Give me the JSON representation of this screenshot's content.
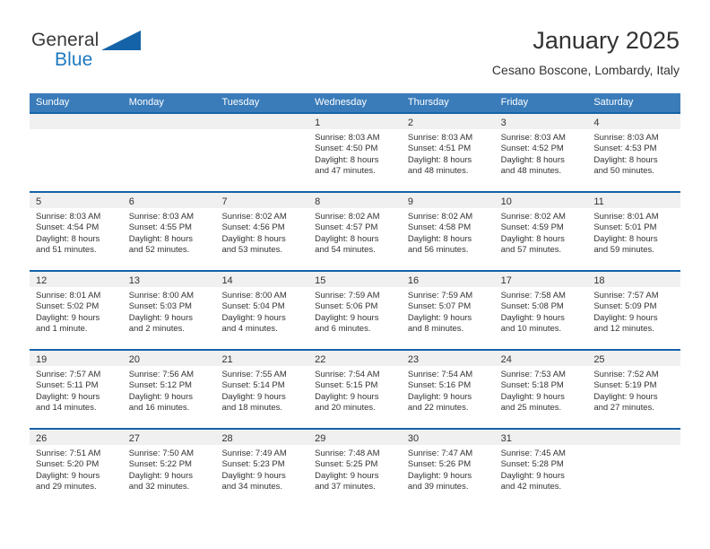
{
  "brand": {
    "word_one": "General",
    "word_two": "Blue",
    "logo_icon": "blue-triangle-icon"
  },
  "header": {
    "title": "January 2025",
    "location": "Cesano Boscone, Lombardy, Italy"
  },
  "colors": {
    "header_blue": "#3a7cba",
    "row_border_blue": "#1463a8",
    "day_band_gray": "#f0f0f0",
    "brand_blue": "#1c79c0",
    "text": "#333333"
  },
  "weekdays": [
    "Sunday",
    "Monday",
    "Tuesday",
    "Wednesday",
    "Thursday",
    "Friday",
    "Saturday"
  ],
  "weeks": [
    [
      {
        "day": "",
        "empty": true
      },
      {
        "day": "",
        "empty": true
      },
      {
        "day": "",
        "empty": true
      },
      {
        "day": "1",
        "sunrise": "Sunrise: 8:03 AM",
        "sunset": "Sunset: 4:50 PM",
        "daylight_1": "Daylight: 8 hours",
        "daylight_2": "and 47 minutes."
      },
      {
        "day": "2",
        "sunrise": "Sunrise: 8:03 AM",
        "sunset": "Sunset: 4:51 PM",
        "daylight_1": "Daylight: 8 hours",
        "daylight_2": "and 48 minutes."
      },
      {
        "day": "3",
        "sunrise": "Sunrise: 8:03 AM",
        "sunset": "Sunset: 4:52 PM",
        "daylight_1": "Daylight: 8 hours",
        "daylight_2": "and 48 minutes."
      },
      {
        "day": "4",
        "sunrise": "Sunrise: 8:03 AM",
        "sunset": "Sunset: 4:53 PM",
        "daylight_1": "Daylight: 8 hours",
        "daylight_2": "and 50 minutes."
      }
    ],
    [
      {
        "day": "5",
        "sunrise": "Sunrise: 8:03 AM",
        "sunset": "Sunset: 4:54 PM",
        "daylight_1": "Daylight: 8 hours",
        "daylight_2": "and 51 minutes."
      },
      {
        "day": "6",
        "sunrise": "Sunrise: 8:03 AM",
        "sunset": "Sunset: 4:55 PM",
        "daylight_1": "Daylight: 8 hours",
        "daylight_2": "and 52 minutes."
      },
      {
        "day": "7",
        "sunrise": "Sunrise: 8:02 AM",
        "sunset": "Sunset: 4:56 PM",
        "daylight_1": "Daylight: 8 hours",
        "daylight_2": "and 53 minutes."
      },
      {
        "day": "8",
        "sunrise": "Sunrise: 8:02 AM",
        "sunset": "Sunset: 4:57 PM",
        "daylight_1": "Daylight: 8 hours",
        "daylight_2": "and 54 minutes."
      },
      {
        "day": "9",
        "sunrise": "Sunrise: 8:02 AM",
        "sunset": "Sunset: 4:58 PM",
        "daylight_1": "Daylight: 8 hours",
        "daylight_2": "and 56 minutes."
      },
      {
        "day": "10",
        "sunrise": "Sunrise: 8:02 AM",
        "sunset": "Sunset: 4:59 PM",
        "daylight_1": "Daylight: 8 hours",
        "daylight_2": "and 57 minutes."
      },
      {
        "day": "11",
        "sunrise": "Sunrise: 8:01 AM",
        "sunset": "Sunset: 5:01 PM",
        "daylight_1": "Daylight: 8 hours",
        "daylight_2": "and 59 minutes."
      }
    ],
    [
      {
        "day": "12",
        "sunrise": "Sunrise: 8:01 AM",
        "sunset": "Sunset: 5:02 PM",
        "daylight_1": "Daylight: 9 hours",
        "daylight_2": "and 1 minute."
      },
      {
        "day": "13",
        "sunrise": "Sunrise: 8:00 AM",
        "sunset": "Sunset: 5:03 PM",
        "daylight_1": "Daylight: 9 hours",
        "daylight_2": "and 2 minutes."
      },
      {
        "day": "14",
        "sunrise": "Sunrise: 8:00 AM",
        "sunset": "Sunset: 5:04 PM",
        "daylight_1": "Daylight: 9 hours",
        "daylight_2": "and 4 minutes."
      },
      {
        "day": "15",
        "sunrise": "Sunrise: 7:59 AM",
        "sunset": "Sunset: 5:06 PM",
        "daylight_1": "Daylight: 9 hours",
        "daylight_2": "and 6 minutes."
      },
      {
        "day": "16",
        "sunrise": "Sunrise: 7:59 AM",
        "sunset": "Sunset: 5:07 PM",
        "daylight_1": "Daylight: 9 hours",
        "daylight_2": "and 8 minutes."
      },
      {
        "day": "17",
        "sunrise": "Sunrise: 7:58 AM",
        "sunset": "Sunset: 5:08 PM",
        "daylight_1": "Daylight: 9 hours",
        "daylight_2": "and 10 minutes."
      },
      {
        "day": "18",
        "sunrise": "Sunrise: 7:57 AM",
        "sunset": "Sunset: 5:09 PM",
        "daylight_1": "Daylight: 9 hours",
        "daylight_2": "and 12 minutes."
      }
    ],
    [
      {
        "day": "19",
        "sunrise": "Sunrise: 7:57 AM",
        "sunset": "Sunset: 5:11 PM",
        "daylight_1": "Daylight: 9 hours",
        "daylight_2": "and 14 minutes."
      },
      {
        "day": "20",
        "sunrise": "Sunrise: 7:56 AM",
        "sunset": "Sunset: 5:12 PM",
        "daylight_1": "Daylight: 9 hours",
        "daylight_2": "and 16 minutes."
      },
      {
        "day": "21",
        "sunrise": "Sunrise: 7:55 AM",
        "sunset": "Sunset: 5:14 PM",
        "daylight_1": "Daylight: 9 hours",
        "daylight_2": "and 18 minutes."
      },
      {
        "day": "22",
        "sunrise": "Sunrise: 7:54 AM",
        "sunset": "Sunset: 5:15 PM",
        "daylight_1": "Daylight: 9 hours",
        "daylight_2": "and 20 minutes."
      },
      {
        "day": "23",
        "sunrise": "Sunrise: 7:54 AM",
        "sunset": "Sunset: 5:16 PM",
        "daylight_1": "Daylight: 9 hours",
        "daylight_2": "and 22 minutes."
      },
      {
        "day": "24",
        "sunrise": "Sunrise: 7:53 AM",
        "sunset": "Sunset: 5:18 PM",
        "daylight_1": "Daylight: 9 hours",
        "daylight_2": "and 25 minutes."
      },
      {
        "day": "25",
        "sunrise": "Sunrise: 7:52 AM",
        "sunset": "Sunset: 5:19 PM",
        "daylight_1": "Daylight: 9 hours",
        "daylight_2": "and 27 minutes."
      }
    ],
    [
      {
        "day": "26",
        "sunrise": "Sunrise: 7:51 AM",
        "sunset": "Sunset: 5:20 PM",
        "daylight_1": "Daylight: 9 hours",
        "daylight_2": "and 29 minutes."
      },
      {
        "day": "27",
        "sunrise": "Sunrise: 7:50 AM",
        "sunset": "Sunset: 5:22 PM",
        "daylight_1": "Daylight: 9 hours",
        "daylight_2": "and 32 minutes."
      },
      {
        "day": "28",
        "sunrise": "Sunrise: 7:49 AM",
        "sunset": "Sunset: 5:23 PM",
        "daylight_1": "Daylight: 9 hours",
        "daylight_2": "and 34 minutes."
      },
      {
        "day": "29",
        "sunrise": "Sunrise: 7:48 AM",
        "sunset": "Sunset: 5:25 PM",
        "daylight_1": "Daylight: 9 hours",
        "daylight_2": "and 37 minutes."
      },
      {
        "day": "30",
        "sunrise": "Sunrise: 7:47 AM",
        "sunset": "Sunset: 5:26 PM",
        "daylight_1": "Daylight: 9 hours",
        "daylight_2": "and 39 minutes."
      },
      {
        "day": "31",
        "sunrise": "Sunrise: 7:45 AM",
        "sunset": "Sunset: 5:28 PM",
        "daylight_1": "Daylight: 9 hours",
        "daylight_2": "and 42 minutes."
      },
      {
        "day": "",
        "empty": true
      }
    ]
  ]
}
